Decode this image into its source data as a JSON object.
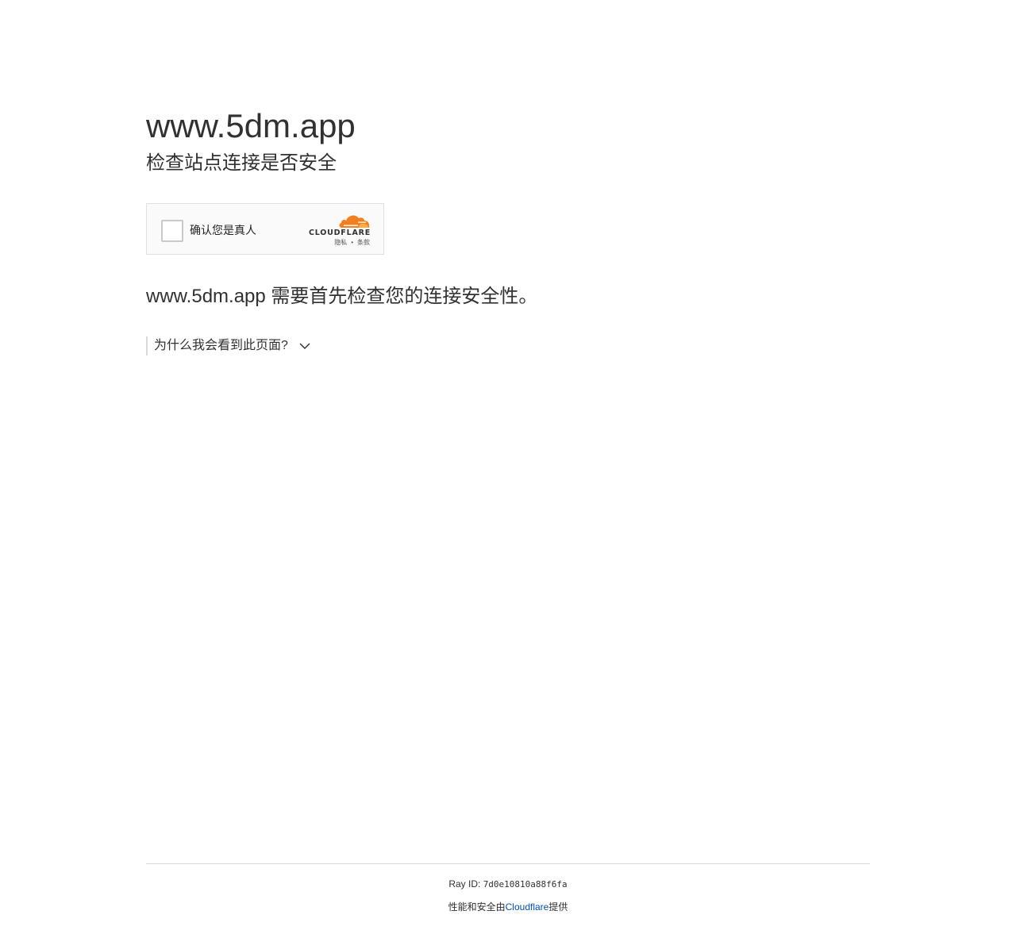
{
  "header": {
    "site_title": "www.5dm.app",
    "subtitle": "检查站点连接是否安全"
  },
  "challenge_widget": {
    "checkbox_label": "确认您是真人",
    "brand": "CLOUDFLARE",
    "privacy_link": "隐私",
    "separator": "•",
    "terms_link": "条款",
    "brand_color": "#f38020"
  },
  "main": {
    "notice": "www.5dm.app 需要首先检查您的连接安全性。",
    "why_toggle": "为什么我会看到此页面?"
  },
  "footer": {
    "ray_label": "Ray ID: ",
    "ray_id": "7d0e10810a88f6fa",
    "performance_prefix": "性能和安全由",
    "provider_link": "Cloudflare",
    "performance_suffix": "提供",
    "link_color": "#0051c3"
  }
}
